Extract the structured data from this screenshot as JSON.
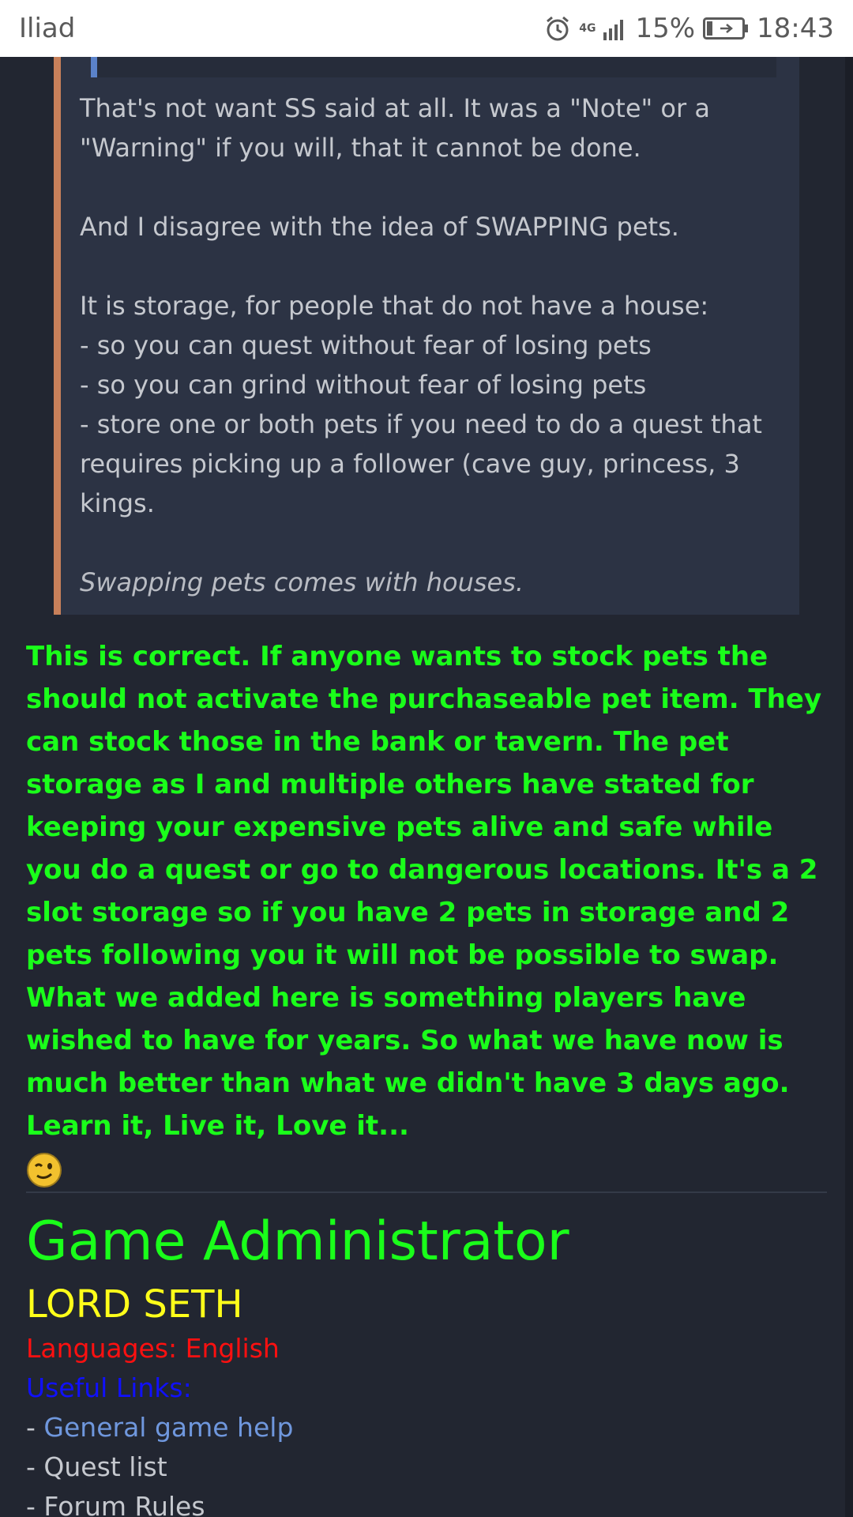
{
  "status_bar": {
    "carrier": "Iliad",
    "network": "4G",
    "battery": "15%",
    "time": "18:43",
    "icons": [
      "alarm-icon",
      "signal-icon",
      "battery-icon"
    ]
  },
  "quote": {
    "paragraphs": [
      "That's not want SS said at all. It was a \"Note\" or a \"Warning\" if you will, that it cannot be done.",
      "And I disagree with the idea of SWAPPING pets."
    ],
    "list_intro": "It is storage, for people that do not have a house:",
    "list_items": [
      "- so you can quest without fear of losing pets",
      "- so you can grind without fear of losing pets",
      "- store one or both pets if you need to do a quest that requires picking up a follower (cave guy, princess, 3 kings."
    ],
    "closing": "Swapping pets comes with houses."
  },
  "reply": {
    "paragraph1": "This is correct. If anyone wants to stock pets the should not activate the purchaseable pet item. They can stock those in the bank or tavern. The pet storage as I and multiple others have stated for keeping your expensive pets alive and safe while you do a quest or go to dangerous locations. It's a 2 slot storage so if you have 2 pets in storage and 2 pets following you it will not be possible to swap.",
    "paragraph2": "What we added here is something players have wished to have for years. So what we have now is much better than what we didn't have 3 days ago. Learn it, Live it, Love it...",
    "emoji": "wink-emoji"
  },
  "signature": {
    "title": "Game Administrator",
    "name": "LORD SETH",
    "languages": "Languages: English",
    "links_label": "Useful Links:",
    "dash": "- ",
    "link1": "General game help",
    "line2": "- Quest list",
    "line3": "- Forum Rules"
  },
  "colors": {
    "background": "#222631",
    "quote_bg": "#2c3344",
    "quote_border": "#c8805a",
    "reply_green": "#1aff1a",
    "name_yellow": "#ffff1a",
    "lang_red": "#ff1010",
    "links_blue": "#1010ff",
    "link_color": "#6f97dd"
  }
}
